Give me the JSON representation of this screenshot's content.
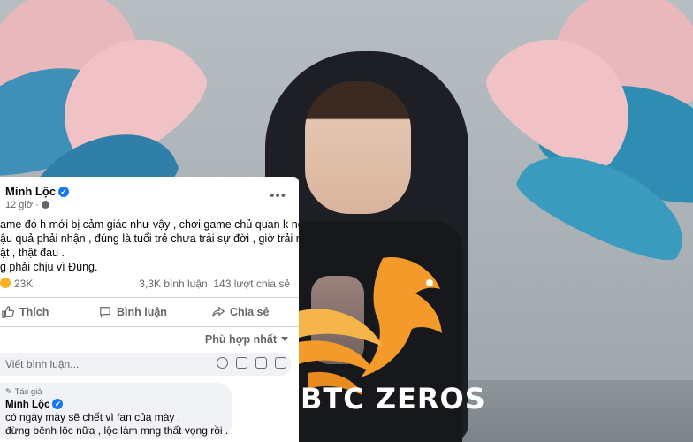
{
  "post": {
    "author": "Minh Lộc",
    "time": "12 giờ ·",
    "more": "•••",
    "lines": [
      "ame đó h mới bị cảm giác như vậy , chơi game chủ quan k nghĩ",
      "ậu quả phải nhận ,   đúng là tuổi trẻ chưa trải sự đời , giờ trải r ,",
      "ật , thật đau .",
      "g phải chịu vì Đúng."
    ],
    "reactions": "23K",
    "comments": "3,3K bình luận",
    "shares": "143 lượt chia sẻ"
  },
  "actions": {
    "like": "Thích",
    "comment": "Bình luận",
    "share": "Chia sẻ"
  },
  "sort": "Phù hợp nhất",
  "comment_placeholder": "Viết bình luận...",
  "reply": {
    "tag": "Tác giả",
    "author": "Minh Lộc",
    "line1": "có ngày mày sẽ chết vì fan của mày .",
    "line2": "đừng bênh lộc nữa , lộc làm mng thất vọng rồi ."
  },
  "logo": {
    "text": "BTC ZEROS"
  },
  "colors": {
    "facebook_blue": "#1877f2",
    "secondary_text": "#65676b",
    "logo_orange": "#f39a2a"
  }
}
